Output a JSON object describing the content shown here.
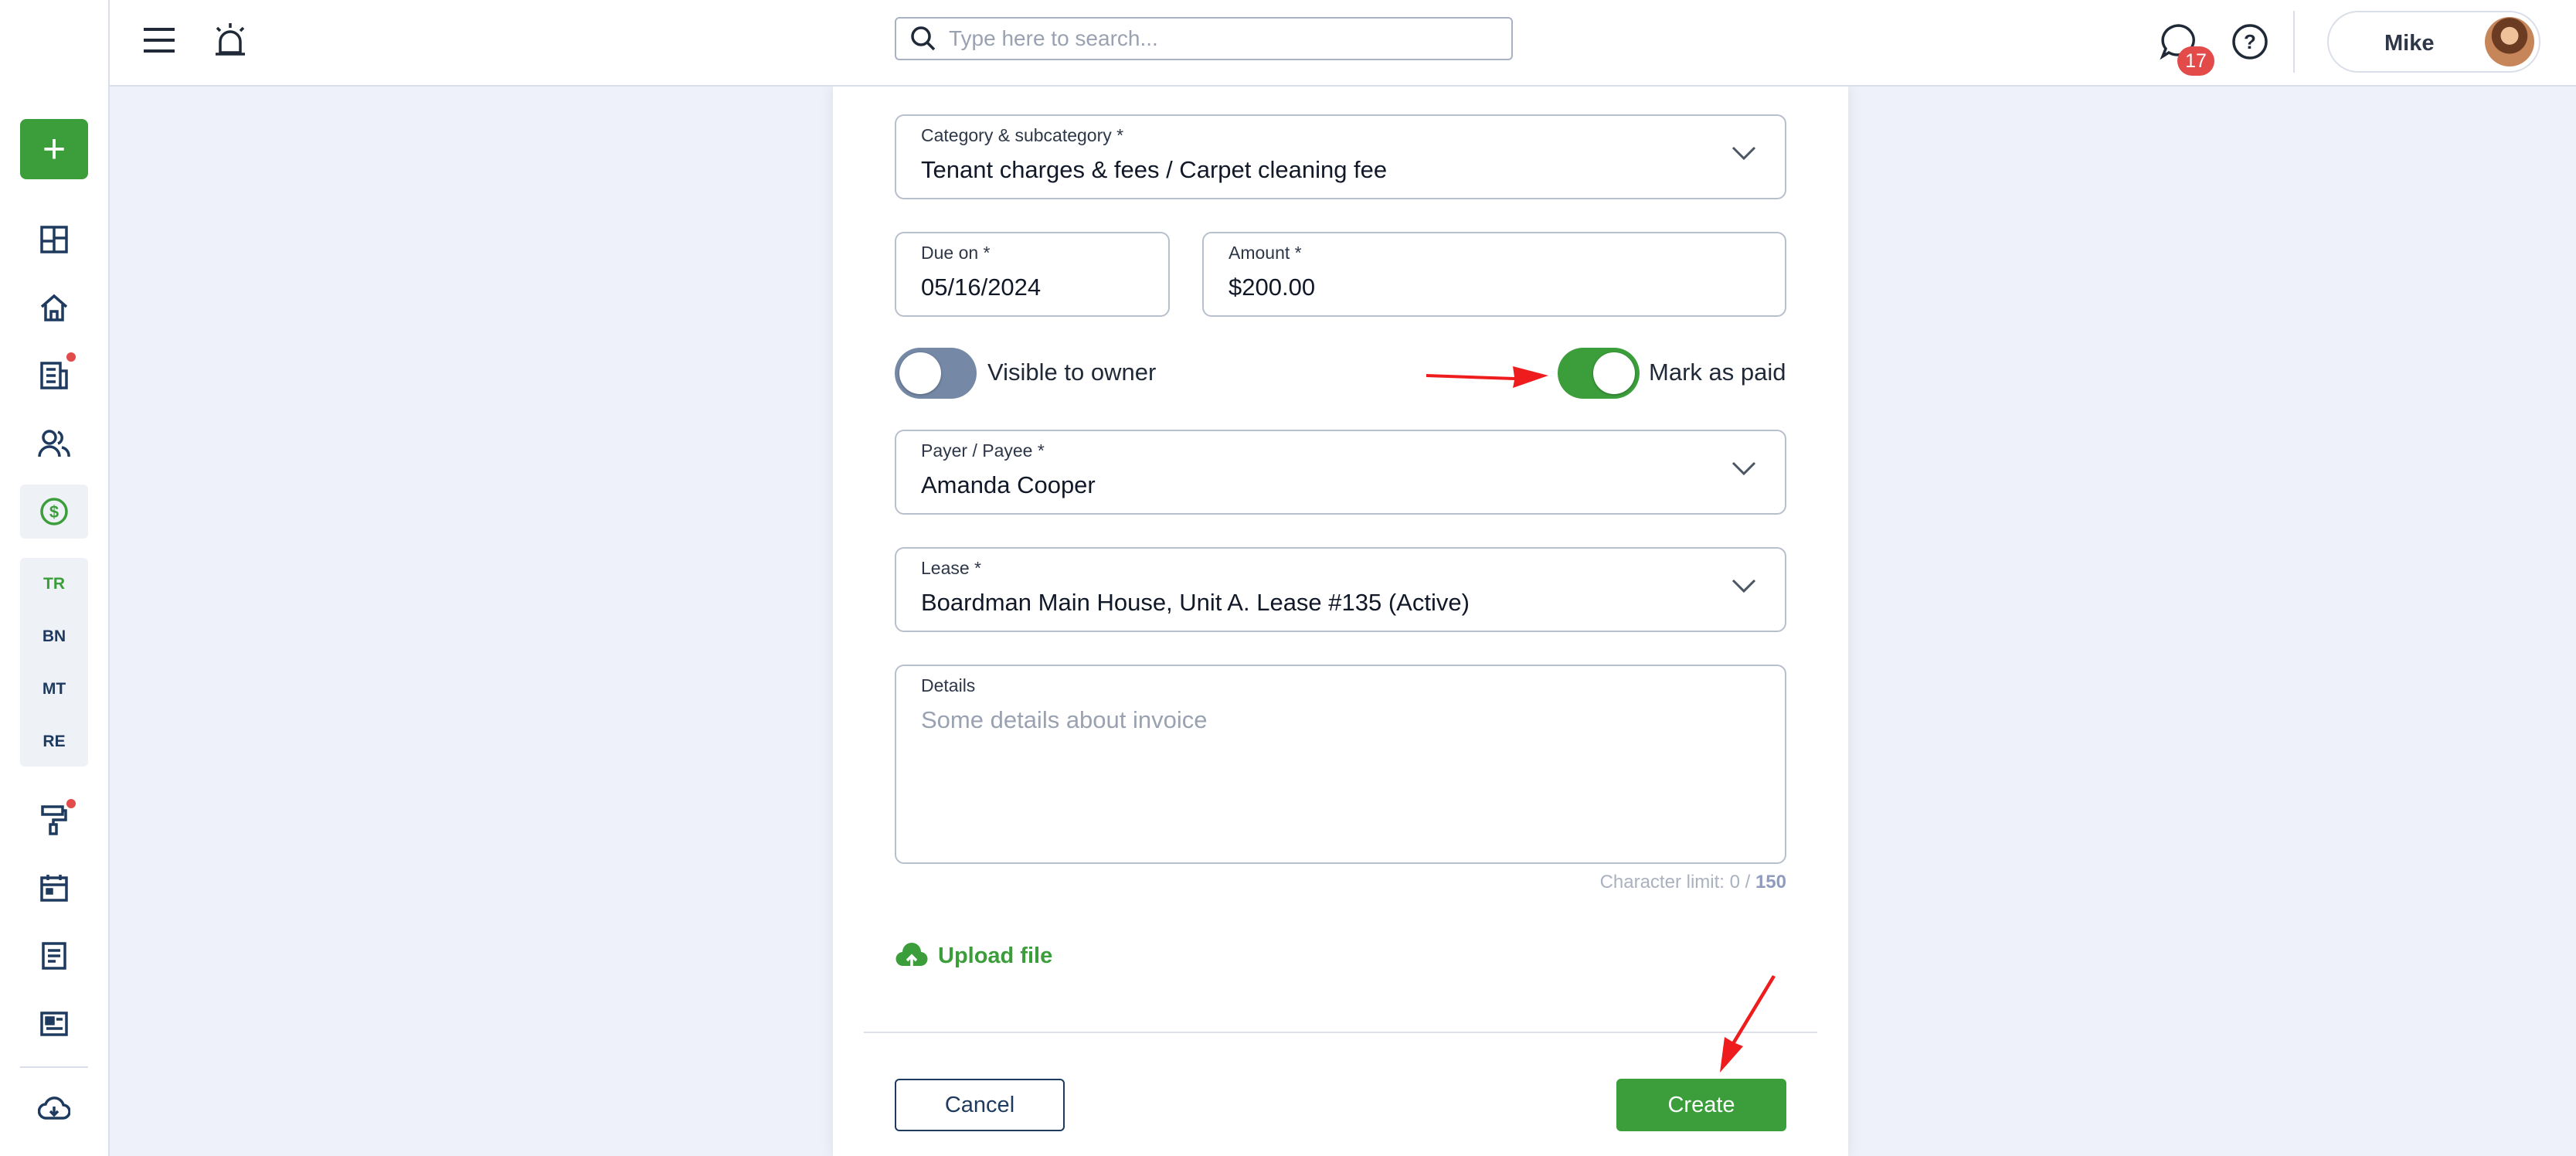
{
  "header": {
    "search_placeholder": "Type here to search...",
    "notification_count": "17",
    "user_name": "Mike"
  },
  "sidebar": {
    "add_label": "+",
    "subnav": [
      {
        "label": "TR",
        "active": true
      },
      {
        "label": "BN",
        "active": false
      },
      {
        "label": "MT",
        "active": false
      },
      {
        "label": "RE",
        "active": false
      }
    ]
  },
  "form": {
    "category": {
      "label": "Category & subcategory *",
      "value": "Tenant charges & fees / Carpet cleaning fee"
    },
    "due_on": {
      "label": "Due on *",
      "value": "05/16/2024"
    },
    "amount": {
      "label": "Amount *",
      "value": "$200.00"
    },
    "visible_to_owner": {
      "label": "Visible to owner",
      "on": false
    },
    "mark_as_paid": {
      "label": "Mark as paid",
      "on": true
    },
    "payer": {
      "label": "Payer / Payee *",
      "value": "Amanda Cooper"
    },
    "lease": {
      "label": "Lease *",
      "value": "Boardman Main House, Unit A. Lease #135 (Active)"
    },
    "details": {
      "label": "Details",
      "placeholder": "Some details about invoice"
    },
    "char_limit": {
      "prefix": "Character limit: 0 / ",
      "max": "150"
    },
    "upload_label": "Upload file",
    "cancel_label": "Cancel",
    "create_label": "Create"
  },
  "colors": {
    "accent": "#3b9e3b",
    "navy": "#1e3a5f",
    "alert": "#e34b4b",
    "background": "#eef1f9"
  }
}
